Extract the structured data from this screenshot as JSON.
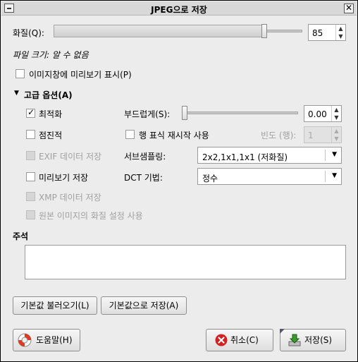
{
  "window": {
    "title": "JPEG으로 저장",
    "close_glyph": "✕"
  },
  "quality": {
    "label": "화질(Q):",
    "value": "85",
    "fraction": 0.85
  },
  "file_size": "파일 크기: 알 수 없음",
  "preview_in_window": {
    "label": "이미지창에 미리보기 표시(P)",
    "checked": false
  },
  "advanced": {
    "header": "고급 옵션(A)",
    "optimize": {
      "label": "최적화",
      "checked": true
    },
    "progressive": {
      "label": "점진적",
      "checked": false
    },
    "exif": {
      "label": "EXIF 데이터 저장",
      "checked": false,
      "disabled": true
    },
    "save_preview": {
      "label": "미리보기 저장",
      "checked": false
    },
    "xmp": {
      "label": "XMP 데이터 저장",
      "checked": false,
      "disabled": true
    },
    "original_quality": {
      "label": "원본 이미지의 화질 설정 사용",
      "checked": false,
      "disabled": true
    },
    "smoothing": {
      "label": "부드럽게(S):",
      "value": "0.00",
      "fraction": 0.0
    },
    "restart_markers": {
      "label": "행 표식 재시작 사용",
      "checked": false
    },
    "frequency": {
      "label": "빈도 (행):",
      "value": "1"
    },
    "subsampling": {
      "label": "서브샘플링:",
      "value": "2x2,1x1,1x1 (저화질)"
    },
    "dct": {
      "label": "DCT 기법:",
      "value": "정수"
    }
  },
  "comment": {
    "label": "주석",
    "value": ""
  },
  "buttons": {
    "load_defaults": "기본값 불러오기(L)",
    "save_defaults": "기본값으로 저장(A)",
    "help": "도움말(H)",
    "cancel": "취소(C)",
    "save": "저장(S)"
  },
  "icons": {
    "help": "lifebuoy-icon",
    "cancel": "cancel-icon",
    "save": "save-icon",
    "expander": "triangle-down-icon"
  },
  "colors": {
    "cancel_red": "#d42020",
    "help_red": "#e03a1e",
    "save_green": "#3a9a2a"
  }
}
